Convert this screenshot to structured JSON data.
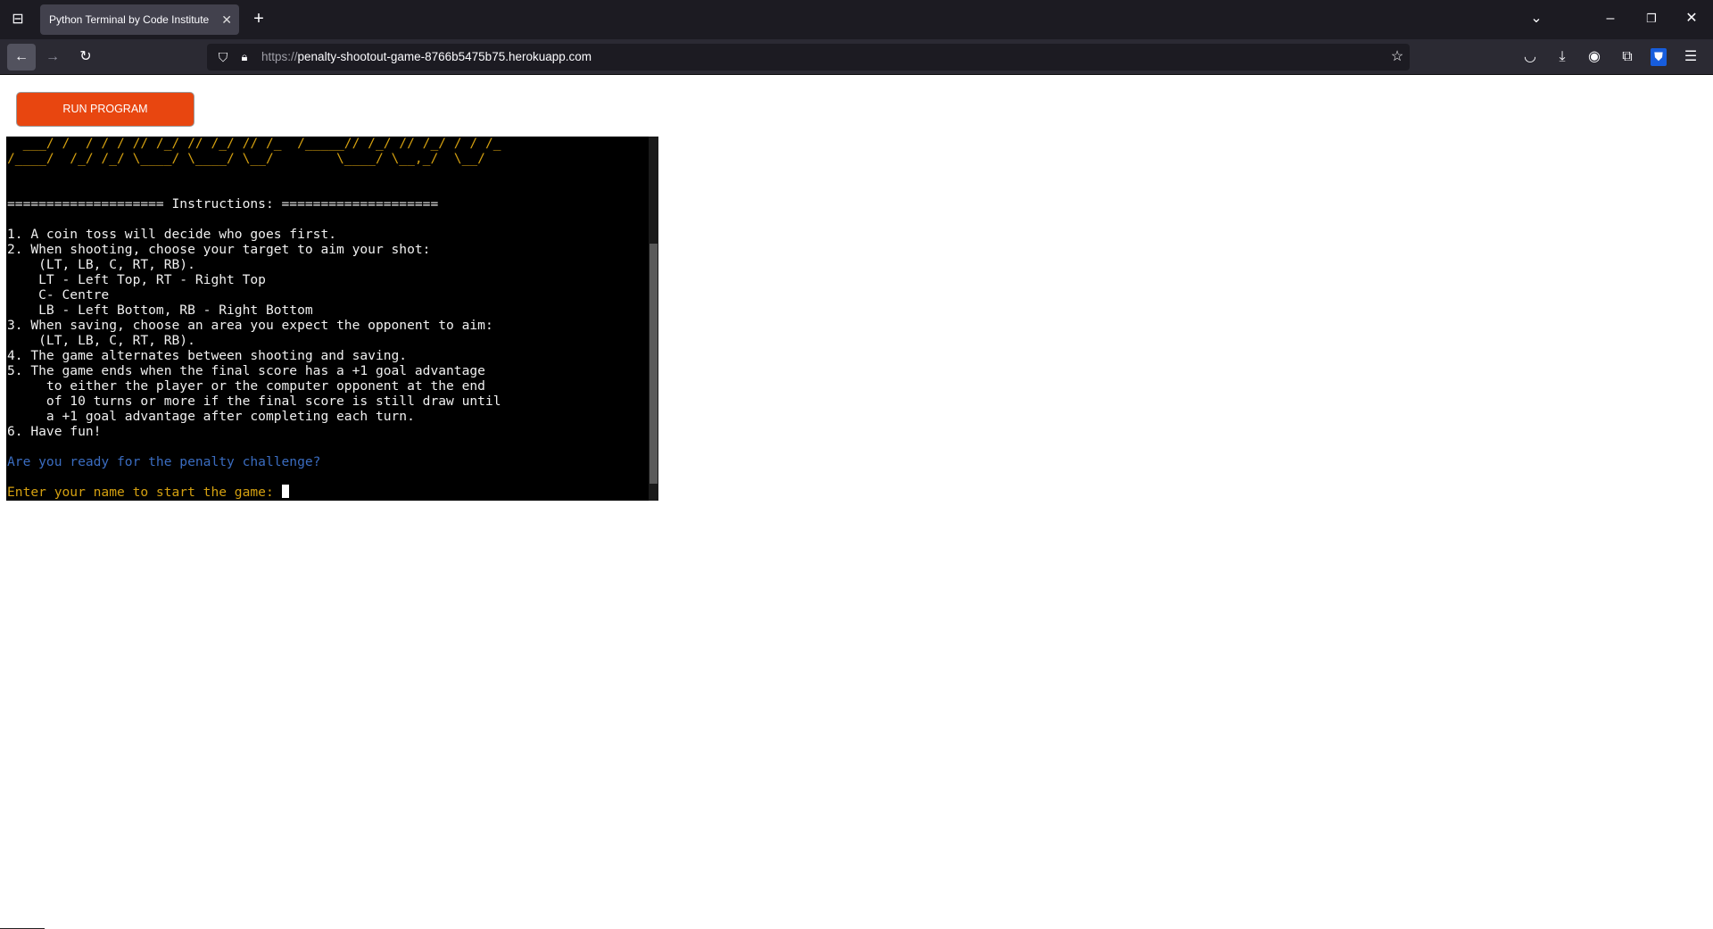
{
  "browser": {
    "tab_title": "Python Terminal by Code Institute",
    "url_scheme": "https://",
    "url_host": "penalty-shootout-game-8766b5475b75.herokuapp.com",
    "icons": [
      "tab-overview-icon",
      "close-icon",
      "new-tab-icon",
      "list-tabs-icon",
      "minimize-icon",
      "restore-icon",
      "close-window-icon",
      "back-icon",
      "forward-icon",
      "reload-icon",
      "shield-icon",
      "lock-icon",
      "bookmark-star-icon",
      "pocket-icon",
      "download-icon",
      "account-icon",
      "extensions-icon",
      "bitwarden-icon",
      "menu-icon"
    ]
  },
  "page": {
    "run_button": "RUN PROGRAM",
    "run_button_color": "#e84610"
  },
  "terminal": {
    "art_line_1": "  ___/ /  / / / // /_/ // /_/ // /_  /_____// /_/ // /_/ / / /_",
    "art_line_2": "/____/  /_/ /_/ \\____/ \\____/ \\__/        \\____/ \\__,_/  \\__/",
    "instructions_header": "==================== Instructions: ====================",
    "instructions": [
      "1. A coin toss will decide who goes first.",
      "2. When shooting, choose your target to aim your shot:",
      "    (LT, LB, C, RT, RB).",
      "    LT - Left Top, RT - Right Top",
      "    C- Centre",
      "    LB - Left Bottom, RB - Right Bottom",
      "3. When saving, choose an area you expect the opponent to aim:",
      "    (LT, LB, C, RT, RB).",
      "4. The game alternates between shooting and saving.",
      "5. The game ends when the final score has a +1 goal advantage",
      "     to either the player or the computer opponent at the end",
      "     of 10 turns or more if the final score is still draw until",
      "     a +1 goal advantage after completing each turn.",
      "6. Have fun!"
    ],
    "question": "Are you ready for the penalty challenge?",
    "prompt": "Enter your name to start the game: ",
    "colors": {
      "art": "#d4a010",
      "question": "#3a6cc0",
      "prompt": "#d4a010",
      "text": "#f0f0f0",
      "background": "#000000"
    }
  }
}
